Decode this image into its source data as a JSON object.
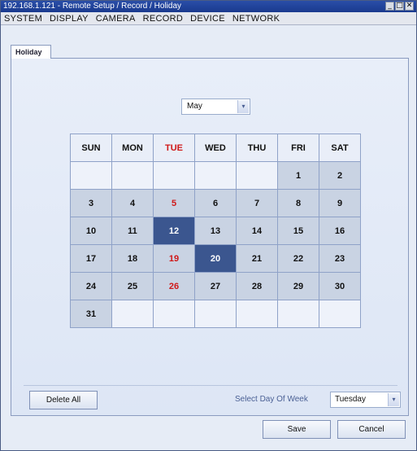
{
  "window": {
    "title": "192.168.1.121 - Remote Setup / Record / Holiday",
    "minimize": "_",
    "maximize": "□",
    "close": "✕"
  },
  "menu": [
    "SYSTEM",
    "DISPLAY",
    "CAMERA",
    "RECORD",
    "DEVICE",
    "NETWORK"
  ],
  "tab": {
    "label": "Holiday"
  },
  "month_select": {
    "value": "May",
    "arrow": "▾"
  },
  "calendar": {
    "headers": [
      "SUN",
      "MON",
      "TUE",
      "WED",
      "THU",
      "FRI",
      "SAT"
    ],
    "weeks": [
      [
        "",
        "",
        "",
        "",
        "",
        "1",
        "2"
      ],
      [
        "3",
        "4",
        "5",
        "6",
        "7",
        "8",
        "9"
      ],
      [
        "10",
        "11",
        "12",
        "13",
        "14",
        "15",
        "16"
      ],
      [
        "17",
        "18",
        "19",
        "20",
        "21",
        "22",
        "23"
      ],
      [
        "24",
        "25",
        "26",
        "27",
        "28",
        "29",
        "30"
      ],
      [
        "31",
        "",
        "",
        "",
        "",
        "",
        ""
      ]
    ],
    "highlight_column": "TUE",
    "selected_days": [
      "12",
      "20"
    ],
    "colors": {
      "selected": "#3b568f",
      "holiday_text": "#d01818"
    }
  },
  "footer": {
    "delete_all": "Delete All",
    "select_day_label": "Select Day Of Week",
    "day_select": {
      "value": "Tuesday",
      "arrow": "▾"
    },
    "save": "Save",
    "cancel": "Cancel"
  }
}
